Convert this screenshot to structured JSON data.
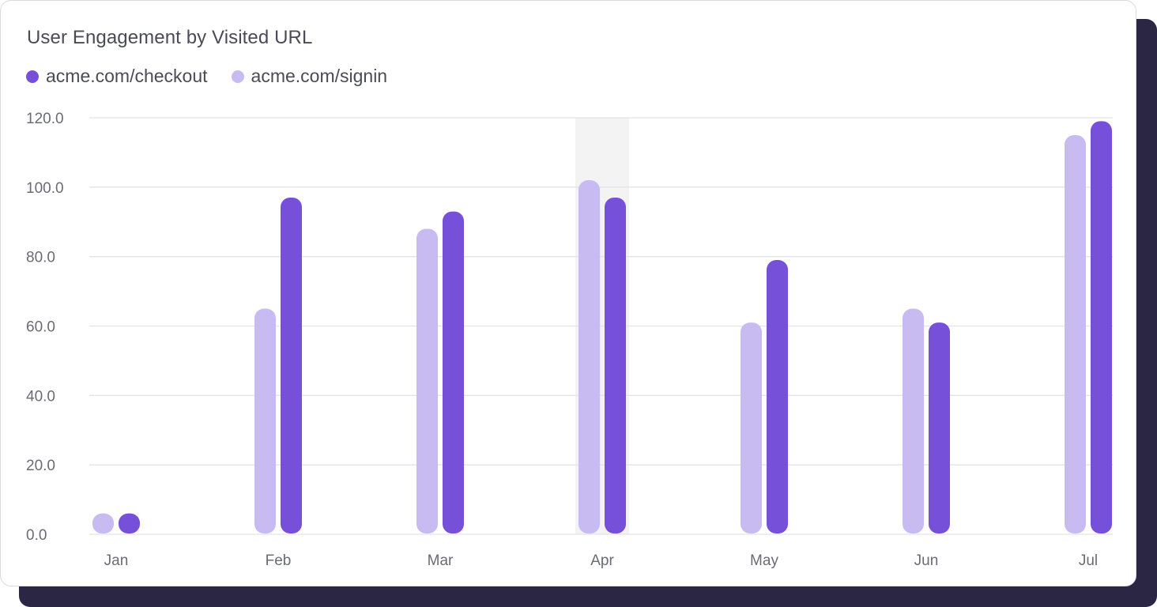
{
  "card": {
    "title": "User Engagement by Visited URL"
  },
  "legend": [
    {
      "label": "acme.com/checkout",
      "color": "#7650d8"
    },
    {
      "label": "acme.com/signin",
      "color": "#c8bbf1"
    }
  ],
  "chart_data": {
    "type": "bar",
    "title": "User Engagement by Visited URL",
    "xlabel": "",
    "ylabel": "",
    "categories": [
      "Jan",
      "Feb",
      "Mar",
      "Apr",
      "May",
      "Jun",
      "Jul"
    ],
    "series": [
      {
        "name": "acme.com/signin",
        "color": "#c8bbf1",
        "values": [
          6,
          65,
          88,
          102,
          61,
          65,
          115
        ]
      },
      {
        "name": "acme.com/checkout",
        "color": "#7650d8",
        "values": [
          6,
          97,
          93,
          97,
          79,
          61,
          119
        ]
      }
    ],
    "ylim": [
      0,
      120
    ],
    "yticks": [
      "0.0",
      "20.0",
      "40.0",
      "60.0",
      "80.0",
      "100.0",
      "120.0"
    ],
    "grid": true,
    "legend_position": "top-left",
    "highlighted_category": "Apr",
    "highlight_color": "#f3f3f3"
  }
}
